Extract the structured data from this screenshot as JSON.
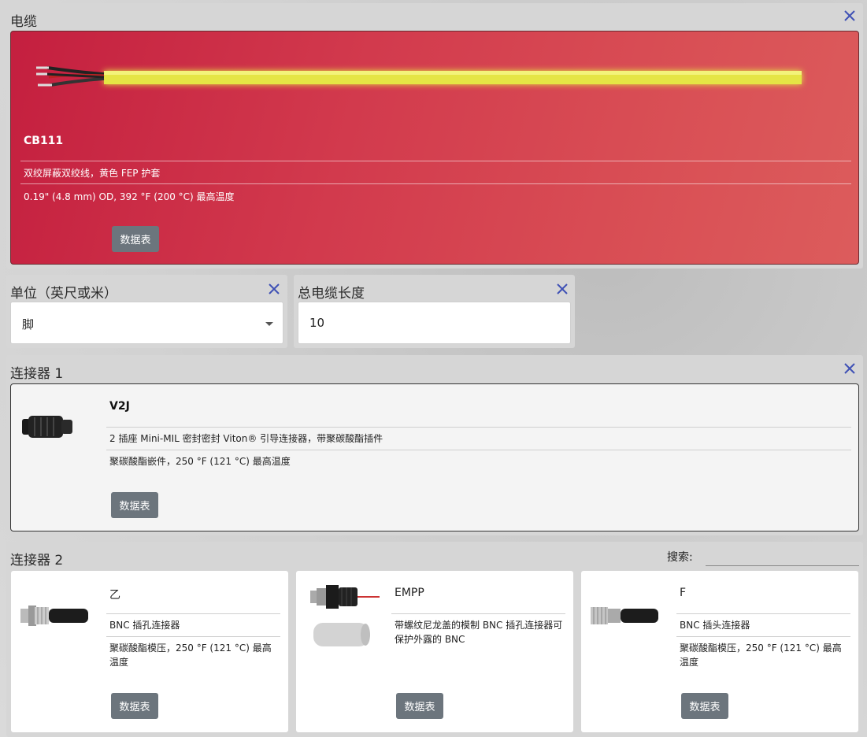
{
  "cable": {
    "title": "电缆",
    "name": "CB111",
    "desc1": "双绞屏蔽双绞线，黄色 FEP 护套",
    "desc2": "0.19\" (4.8 mm) OD, 392 °F (200 °C) 最高温度",
    "datasheet": "数据表"
  },
  "units": {
    "title": "单位（英尺或米）",
    "value": "脚"
  },
  "length": {
    "title": "总电缆长度",
    "value": "10"
  },
  "connector1": {
    "title": "连接器 1",
    "name": "V2J",
    "desc1": "2 插座 Mini-MIL 密封密封 Viton® 引导连接器，带聚碳酸酯插件",
    "desc2": "聚碳酸酯嵌件，250 °F (121 °C) 最高温度",
    "datasheet": "数据表"
  },
  "connector2": {
    "title": "连接器 2",
    "search_label": "搜索:",
    "search_value": "",
    "options": [
      {
        "name": "乙",
        "desc1": "BNC 插孔连接器",
        "desc2": "聚碳酸酯模压，250 °F (121 °C) 最高温度",
        "datasheet": "数据表"
      },
      {
        "name": "EMPP",
        "desc1": "带螺纹尼龙盖的模制 BNC 插孔连接器可保护外露的 BNC",
        "datasheet": "数据表"
      },
      {
        "name": "F",
        "desc1": "BNC 插头连接器",
        "desc2": "聚碳酸酯模压，250 °F (121 °C) 最高温度",
        "datasheet": "数据表"
      }
    ]
  },
  "colors": {
    "cable_card": "#d23a4d",
    "close_icon": "#3f51b5",
    "button": "#6c757d",
    "cable_jacket": "#e8e84a"
  },
  "icons": [
    "close-icon",
    "dropdown-caret-icon"
  ]
}
